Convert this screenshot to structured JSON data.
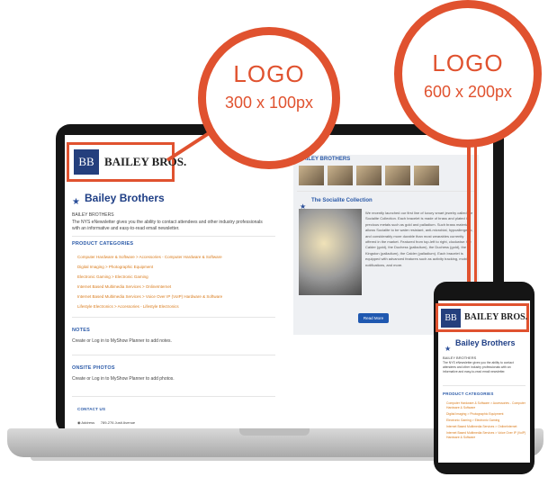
{
  "callouts": {
    "desktop": {
      "label": "LOGO",
      "size": "300 x 100px"
    },
    "mobile": {
      "label": "LOGO",
      "size": "600 x 200px"
    }
  },
  "brand": {
    "initials": "BB",
    "name": "BAILEY BROS.",
    "company": "Bailey Brothers",
    "company_caps": "BAILEY BROTHERS",
    "description": "The NYS eNewsletter gives you the ability to contact attendees and other industry professionals with an informative and easy-to-read email newsletter."
  },
  "sections": {
    "product_categories": "PRODUCT CATEGORIES",
    "notes": "NOTES",
    "notes_text": "Create or Log in to MyShow Planner to add notes.",
    "onsite_photos": "ONSITE PHOTOS",
    "photos_text": "Create or Log in to MyShow Planner to add photos.",
    "contact_us": "CONTACT US",
    "address_label": "Address",
    "address": "789-276 Justi Avenue"
  },
  "categories": [
    "Computer Hardware & Software > Accessories - Computer Hardware & Software",
    "Digital Imaging > Photographic Equipment",
    "Electronic Gaming > Electronic Gaming",
    "Internet Based Multimedia Services > OnlineInternet",
    "Internet Based Multimedia Services > Voice Over IP (VoIP) Hardware & Software",
    "Lifestyle Electronics > Accessories - Lifestyle Electronics"
  ],
  "panel": {
    "title": "BAILEY BROTHERS",
    "social_title": "The Socialite Collection",
    "desc": "We recently launched our first line of luxury smart jewelry called the Socialite Collection. Each bracelet is made of brass and plated in precious metals such as gold and palladium. Such brass material allows Socialite to be water resistant, anti-microbial, hypoallergenic, and considerably more durable than most wearables currently offered in the market. Featured from top-left to right, clockwise: the Calder (gold), the Duchess (palladium), the Duchess (gold), the Kingston (palladium), the Calder (palladium). Each bracelet is equipped with advanced features such as activity tracking, mobile notifications, and more.",
    "read_more": "Read More"
  },
  "mobile": {
    "company": "Bailey Brothers",
    "company_caps": "BAILEY BROTHERS",
    "description": "The NYS eNewsletter gives you the ability to contact attendees and other industry professionals with an informative and easy-to-read email newsletter.",
    "product_categories": "PRODUCT CATEGORIES",
    "categories": [
      "Computer Hardware & Software > Accessories - Computer Hardware & Software",
      "Digital Imaging > Photographic Equipment",
      "Electronic Gaming > Electronic Gaming",
      "Internet Based Multimedia Services > OnlineInternet",
      "Internet Based Multimedia Services > Voice Over IP (VoIP) Hardware & Software"
    ]
  },
  "colors": {
    "accent": "#e0522f",
    "brand_blue": "#243f7d",
    "link": "#d97a1a"
  }
}
